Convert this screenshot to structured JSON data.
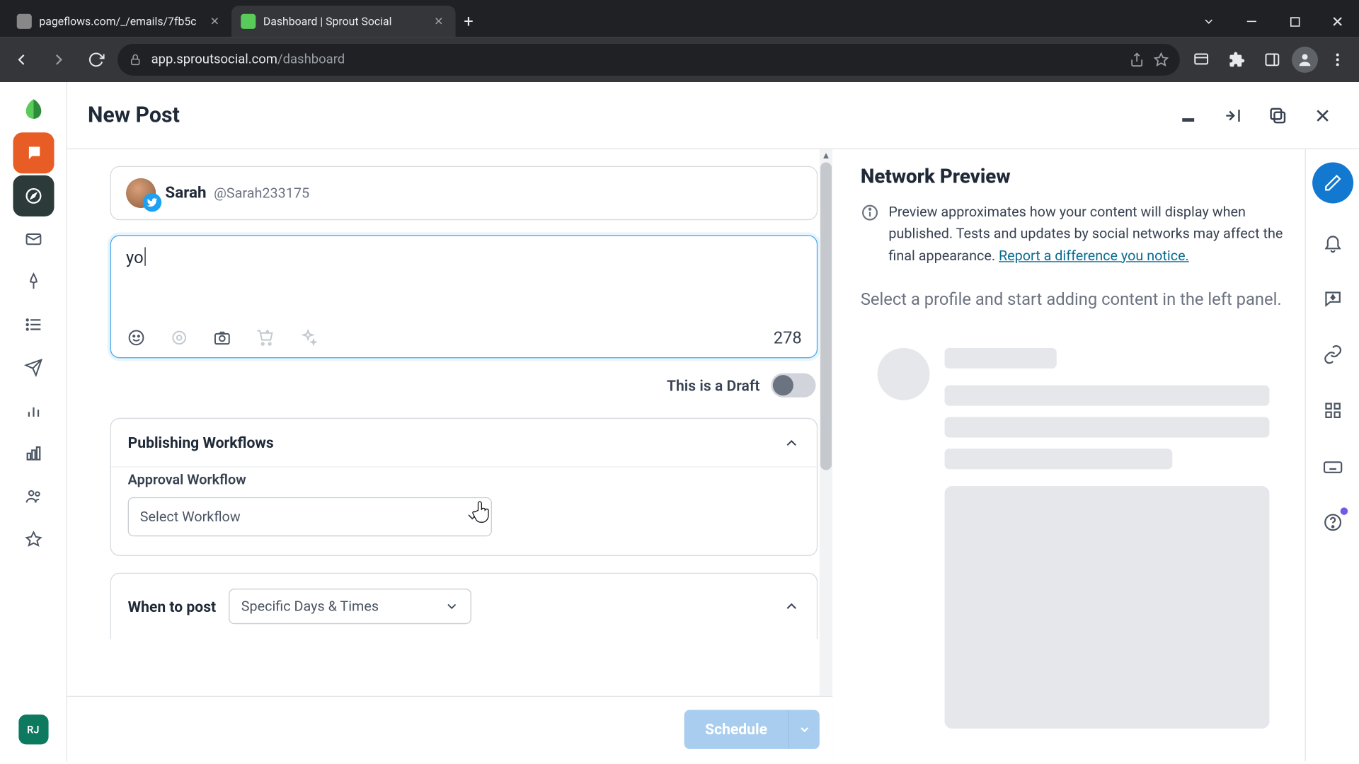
{
  "browser": {
    "tabs": [
      {
        "title": "pageflows.com/_/emails/7fb5c",
        "active": false
      },
      {
        "title": "Dashboard | Sprout Social",
        "active": true
      }
    ],
    "url_host": "app.sproutsocial.com",
    "url_path": "/dashboard"
  },
  "header": {
    "title": "New Post"
  },
  "profile": {
    "name": "Sarah",
    "handle": "@Sarah233175"
  },
  "compose": {
    "text": "yo",
    "char_count": "278"
  },
  "draft": {
    "label": "This is a Draft",
    "on": false
  },
  "workflows": {
    "section_title": "Publishing Workflows",
    "approval_label": "Approval Workflow",
    "approval_placeholder": "Select Workflow"
  },
  "when": {
    "label": "When to post",
    "selected": "Specific Days & Times"
  },
  "footer": {
    "schedule": "Schedule"
  },
  "preview": {
    "title": "Network Preview",
    "info": "Preview approximates how your content will display when published. Tests and updates by social networks may affect the final appearance. ",
    "link": "Report a difference you notice.",
    "placeholder": "Select a profile and start adding content in the left panel."
  },
  "rail_avatar": "RJ"
}
